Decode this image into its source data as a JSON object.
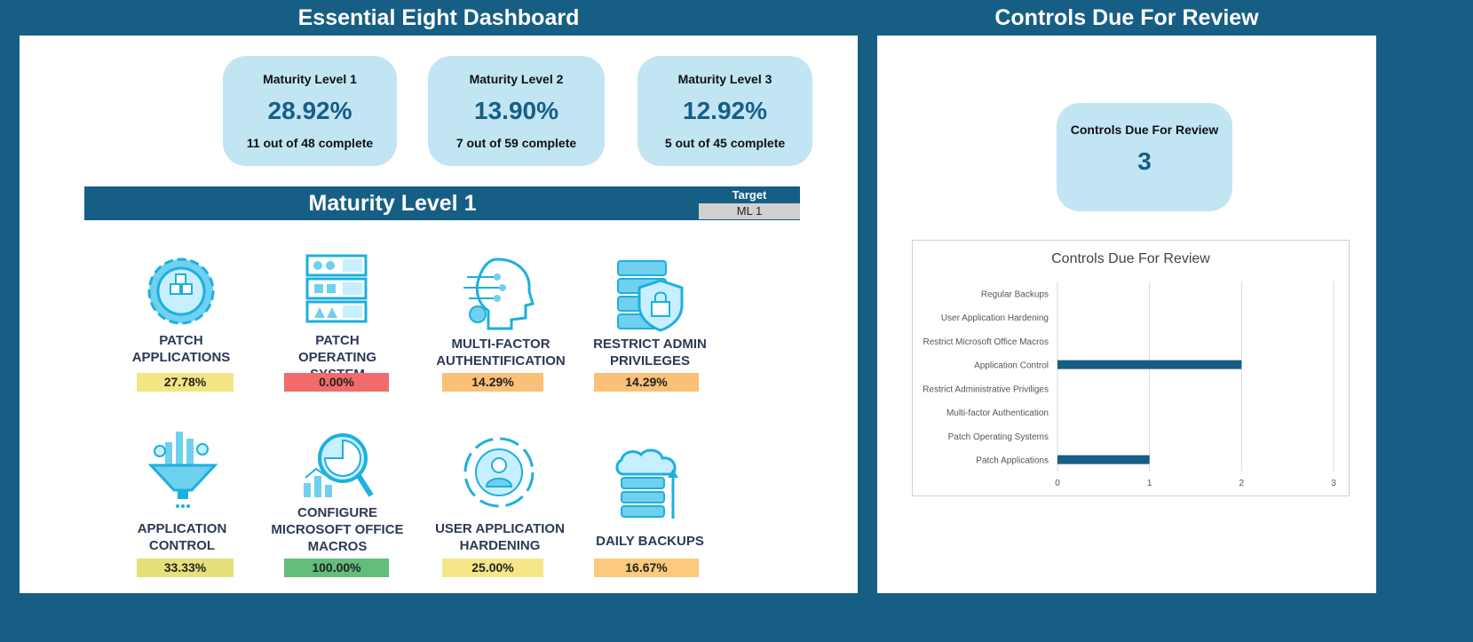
{
  "dashboard": {
    "title": "Essential Eight Dashboard",
    "cards": [
      {
        "title": "Maturity Level 1",
        "value": "28.92%",
        "subtitle": "11 out of 48 complete"
      },
      {
        "title": "Maturity Level 2",
        "value": "13.90%",
        "subtitle": "7 out of 59 complete"
      },
      {
        "title": "Maturity Level 3",
        "value": "12.92%",
        "subtitle": "5 out of 45 complete"
      }
    ],
    "section_title": "Maturity Level 1",
    "target_label": "Target",
    "target_value": "ML 1",
    "tiles": [
      {
        "label": "PATCH APPLICATIONS",
        "value": "27.78%",
        "color": "#f3e584",
        "icon": "gear-cubes-icon"
      },
      {
        "label": "PATCH OPERATING SYSTEM",
        "value": "0.00%",
        "color": "#f26b6b",
        "icon": "server-rack-icon"
      },
      {
        "label": "MULTI-FACTOR AUTHENTIFICATION",
        "value": "14.29%",
        "color": "#fbc078",
        "icon": "ai-head-icon"
      },
      {
        "label": "RESTRICT ADMIN PRIVILEGES",
        "value": "14.29%",
        "color": "#fbc078",
        "icon": "server-lock-icon"
      },
      {
        "label": "APPLICATION CONTROL",
        "value": "33.33%",
        "color": "#e6e07a",
        "icon": "funnel-icon"
      },
      {
        "label": "CONFIGURE MICROSOFT OFFICE MACROS",
        "value": "100.00%",
        "color": "#63be7b",
        "icon": "magnifier-chart-icon"
      },
      {
        "label": "USER APPLICATION HARDENING",
        "value": "25.00%",
        "color": "#f5e787",
        "icon": "user-cycle-icon"
      },
      {
        "label": "DAILY BACKUPS",
        "value": "16.67%",
        "color": "#fcca7c",
        "icon": "cloud-server-icon"
      }
    ]
  },
  "review": {
    "title": "Controls Due For Review",
    "card_title": "Controls Due For Review",
    "card_value": "3"
  },
  "chart_data": {
    "type": "bar",
    "orientation": "horizontal",
    "title": "Controls Due For Review",
    "categories": [
      "Regular Backups",
      "User Application Hardening",
      "Restrict Microsoft Office Macros",
      "Application Control",
      "Restrict Administrative Priviliges",
      "Multi-factor Authentication",
      "Patch Operating Systems",
      "Patch Applications"
    ],
    "values": [
      0,
      0,
      0,
      2,
      0,
      0,
      0,
      1
    ],
    "xlim": [
      0,
      3
    ],
    "xticks": [
      "0",
      "1",
      "2",
      "3"
    ],
    "grid": true,
    "bar_color": "#175e85"
  }
}
